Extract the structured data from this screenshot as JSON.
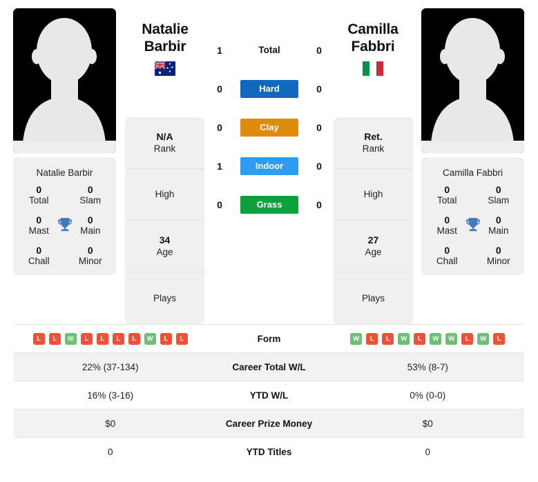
{
  "players": {
    "left": {
      "first_name": "Natalie",
      "last_name": "Barbir",
      "full_name": "Natalie Barbir",
      "flag": "australia-flag",
      "avatar": "player-avatar-placeholder",
      "rank": "N/A",
      "rank_label": "Rank",
      "high_label": "High",
      "high_value": "",
      "age": "34",
      "age_label": "Age",
      "plays_label": "Plays",
      "plays_value": "",
      "titles": {
        "total": "0",
        "total_label": "Total",
        "slam": "0",
        "slam_label": "Slam",
        "mast": "0",
        "mast_label": "Mast",
        "main": "0",
        "main_label": "Main",
        "chall": "0",
        "chall_label": "Chall",
        "minor": "0",
        "minor_label": "Minor"
      },
      "form": [
        "L",
        "L",
        "W",
        "L",
        "L",
        "L",
        "L",
        "W",
        "L",
        "L"
      ],
      "career_total_wl": "22% (37-134)",
      "ytd_wl": "16% (3-16)",
      "career_prize_money": "$0",
      "ytd_titles": "0"
    },
    "right": {
      "first_name": "Camilla",
      "last_name": "Fabbri",
      "full_name": "Camilla Fabbri",
      "flag": "italy-flag",
      "avatar": "player-avatar-placeholder",
      "rank": "Ret.",
      "rank_label": "Rank",
      "high_label": "High",
      "high_value": "",
      "age": "27",
      "age_label": "Age",
      "plays_label": "Plays",
      "plays_value": "",
      "titles": {
        "total": "0",
        "total_label": "Total",
        "slam": "0",
        "slam_label": "Slam",
        "mast": "0",
        "mast_label": "Mast",
        "main": "0",
        "main_label": "Main",
        "chall": "0",
        "chall_label": "Chall",
        "minor": "0",
        "minor_label": "Minor"
      },
      "form": [
        "W",
        "L",
        "L",
        "W",
        "L",
        "W",
        "W",
        "L",
        "W",
        "L"
      ],
      "career_total_wl": "53% (8-7)",
      "ytd_wl": "0% (0-0)",
      "career_prize_money": "$0",
      "ytd_titles": "0"
    }
  },
  "head_to_head": [
    {
      "label": "Total",
      "left": "1",
      "right": "0",
      "color": "",
      "style": "plain"
    },
    {
      "label": "Hard",
      "left": "0",
      "right": "0",
      "color": "#1069bf",
      "style": "badge"
    },
    {
      "label": "Clay",
      "left": "0",
      "right": "0",
      "color": "#dd8c0c",
      "style": "badge"
    },
    {
      "label": "Indoor",
      "left": "1",
      "right": "0",
      "color": "#2f9cf4",
      "style": "badge"
    },
    {
      "label": "Grass",
      "left": "0",
      "right": "0",
      "color": "#0da03c",
      "style": "badge"
    }
  ],
  "stats_rows": [
    {
      "label": "Form",
      "left": "",
      "right": "",
      "type": "form"
    },
    {
      "label": "Career Total W/L",
      "left": "22% (37-134)",
      "right": "53% (8-7)",
      "type": "text"
    },
    {
      "label": "YTD W/L",
      "left": "16% (3-16)",
      "right": "0% (0-0)",
      "type": "text"
    },
    {
      "label": "Career Prize Money",
      "left": "$0",
      "right": "$0",
      "type": "text"
    },
    {
      "label": "YTD Titles",
      "left": "0",
      "right": "0",
      "type": "text"
    }
  ],
  "colors": {
    "win": "#6cc071",
    "loss": "#ef5138",
    "trophy": "#4279bd",
    "card_bg": "#f0f0f0",
    "row_shade": "#f2f2f2"
  }
}
